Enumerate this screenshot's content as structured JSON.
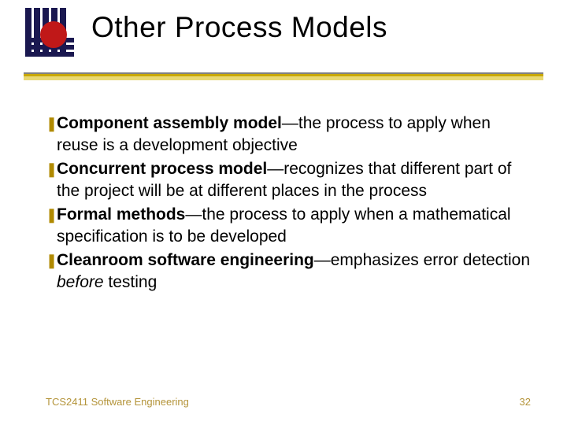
{
  "title": "Other Process Models",
  "bullets": [
    {
      "bold": "Component assembly model",
      "rest": "—the process to apply when reuse is a development objective"
    },
    {
      "bold": "Concurrent process model",
      "rest": "—recognizes that different part of the project will be at different places in the process"
    },
    {
      "bold": "Formal methods",
      "rest": "—the process to apply when a mathematical specification is to be developed"
    },
    {
      "bold": "Cleanroom software engineering",
      "rest": "—emphasizes error detection ",
      "italic": "before",
      "tail": " testing"
    }
  ],
  "footer": {
    "left": "TCS2411 Software Engineering",
    "right": "32"
  },
  "bullet_glyph": "❚"
}
